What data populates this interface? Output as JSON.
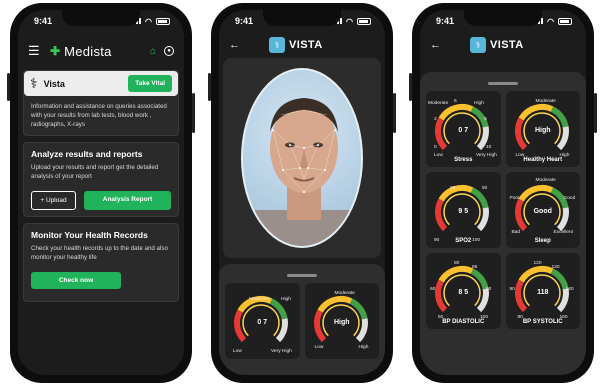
{
  "status_time": "9:41",
  "phone1": {
    "brand": "Medista",
    "vista_card": {
      "title": "Vista",
      "button": "Take Vital",
      "description": "Information and assistance on queries associated with your results from lab tests, blood work , radiographs, X-rays"
    },
    "analyze_card": {
      "title": "Analyze results and reports",
      "description": "Upload your results and report get the detailed analysis of your report",
      "upload_button": "Upload",
      "analysis_button": "Analysis Report"
    },
    "records_card": {
      "title": "Monitor Your Health Records",
      "description": "Check your health records up to the date and also monitor your healthy life",
      "check_button": "Check now"
    }
  },
  "phone2": {
    "logo": "VISTA",
    "gauges": [
      {
        "title": "",
        "value": "0 7",
        "labels": [
          "Moderate",
          "High",
          "Low",
          "Very High"
        ]
      },
      {
        "title": "",
        "value": "High",
        "labels": [
          "Moderate",
          "Low",
          "High"
        ]
      }
    ]
  },
  "phone3": {
    "logo": "VISTA",
    "gauges": [
      {
        "title": "Stress",
        "value": "0 7",
        "labels": [
          "Moderate",
          "6",
          "High",
          "2",
          "8",
          "0",
          "10",
          "Low",
          "Very High"
        ]
      },
      {
        "title": "Healthy Heart",
        "value": "High",
        "labels": [
          "Moderate",
          "Low",
          "High"
        ]
      },
      {
        "title": "SPO2",
        "value": "9 5",
        "labels": [
          "95",
          "92",
          "90",
          "100"
        ]
      },
      {
        "title": "Sleep",
        "value": "Good",
        "labels": [
          "Moderate",
          "Poor",
          "Good",
          "Bad",
          "Excellent"
        ]
      },
      {
        "title": "BP DIASTOLIC",
        "value": "8 5",
        "labels": [
          "80",
          "85",
          "60",
          "90",
          "50",
          "100"
        ]
      },
      {
        "title": "BP SYSTOLIC",
        "value": "118",
        "labels": [
          "120",
          "130",
          "90",
          "140",
          "80",
          "160"
        ]
      }
    ]
  }
}
